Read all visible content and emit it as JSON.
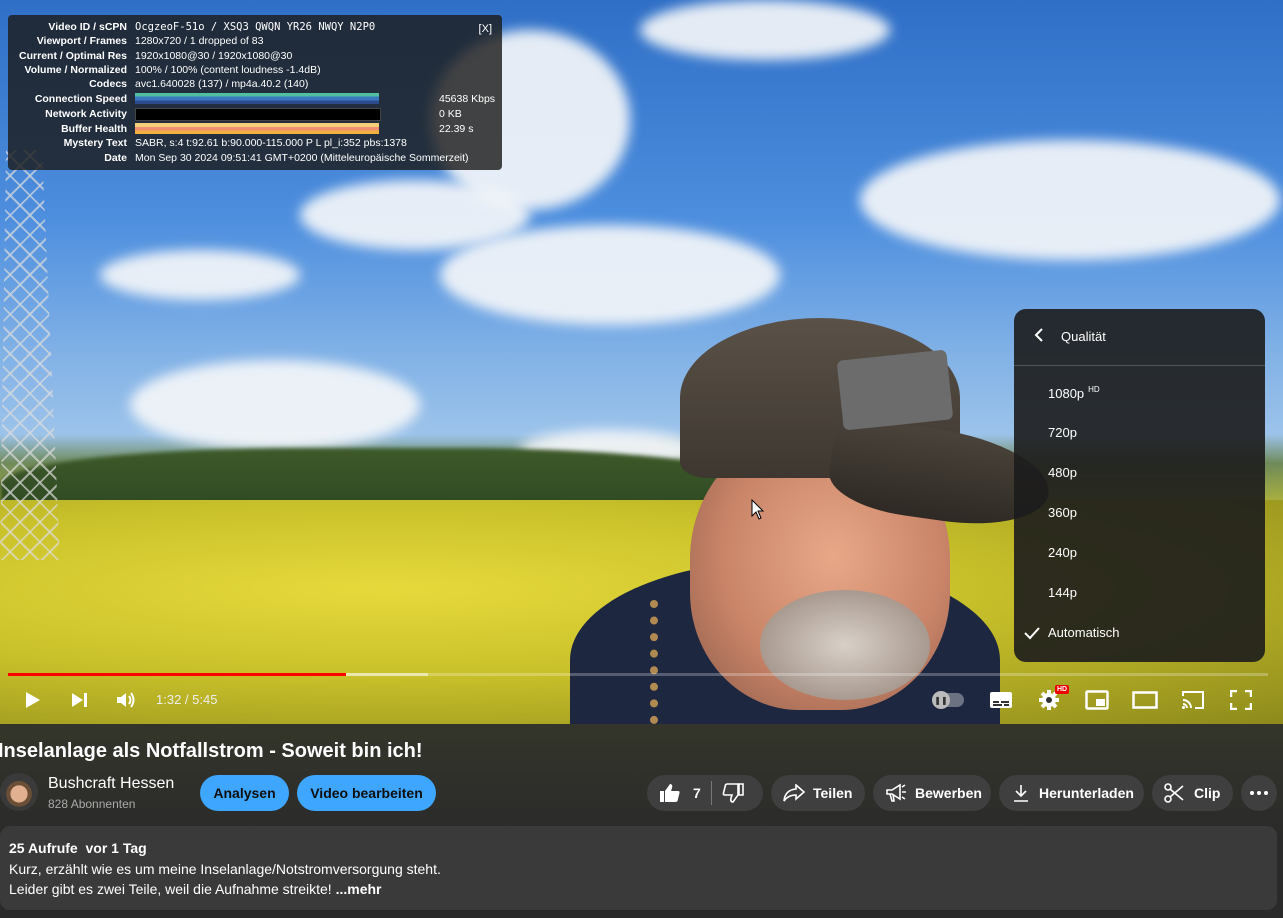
{
  "nerds": {
    "close_label": "[X]",
    "rows": [
      {
        "key": "Video ID / sCPN",
        "value": "OcgzeoF-51o / XSQ3 QWQN YR26 NWQY N2P0"
      },
      {
        "key": "Viewport / Frames",
        "value": "1280x720 / 1 dropped of 83"
      },
      {
        "key": "Current / Optimal Res",
        "value": "1920x1080@30 / 1920x1080@30"
      },
      {
        "key": "Volume / Normalized",
        "value": "100% / 100% (content loudness -1.4dB)"
      },
      {
        "key": "Codecs",
        "value": "avc1.640028 (137) / mp4a.40.2 (140)"
      },
      {
        "key": "Connection Speed",
        "value": "45638 Kbps"
      },
      {
        "key": "Network Activity",
        "value": "0 KB"
      },
      {
        "key": "Buffer Health",
        "value": "22.39 s"
      },
      {
        "key": "Mystery Text",
        "value": "SABR, s:4 t:92.61 b:90.000-115.000 P L pl_i:352 pbs:1378"
      },
      {
        "key": "Date",
        "value": "Mon Sep 30 2024 09:51:41 GMT+0200 (Mitteleuropäische Sommerzeit)"
      }
    ]
  },
  "quality_menu": {
    "title": "Qualität",
    "items": [
      {
        "label": "1080p",
        "badge": "HD"
      },
      {
        "label": "720p"
      },
      {
        "label": "480p"
      },
      {
        "label": "360p"
      },
      {
        "label": "240p"
      },
      {
        "label": "144p"
      },
      {
        "label": "Automatisch",
        "selected": true
      }
    ]
  },
  "player": {
    "time": "1:32 / 5:45",
    "progress_fraction": 0.268,
    "buffered_fraction": 0.333,
    "hd_badge": "HD",
    "accent_color": "#ff0000"
  },
  "video": {
    "title": "Inselanlage als Notfallstrom - Soweit bin ich!",
    "channel": "Bushcraft Hessen",
    "subscribers": "828 Abonnenten",
    "analyze_label": "Analysen",
    "edit_label": "Video bearbeiten",
    "likes": "7",
    "share_label": "Teilen",
    "promote_label": "Bewerben",
    "download_label": "Herunterladen",
    "clip_label": "Clip"
  },
  "description": {
    "meta": "25 Aufrufe  vor 1 Tag",
    "line1": "Kurz, erzählt wie es um meine Inselanlage/Notstromversorgung steht.",
    "line2": "Leider gibt es zwei Teile, weil die Aufnahme streikte! ",
    "more_label": "...mehr"
  },
  "icons": [
    "play-icon",
    "next-icon",
    "volume-icon",
    "autoplay-toggle",
    "subtitles-icon",
    "settings-icon",
    "miniplayer-icon",
    "theater-icon",
    "cast-icon",
    "fullscreen-icon",
    "like-icon",
    "dislike-icon",
    "share-icon",
    "promote-icon",
    "download-icon",
    "clip-icon",
    "more-icon",
    "back-chevron-icon",
    "check-icon"
  ]
}
